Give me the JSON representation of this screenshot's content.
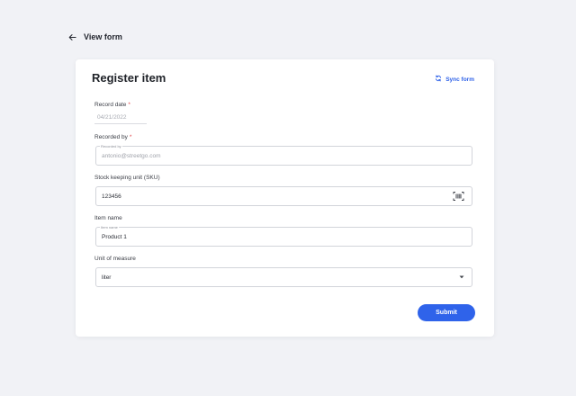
{
  "nav": {
    "back_label": "View form"
  },
  "form": {
    "title": "Register item",
    "sync_label": "Sync form",
    "record_date": {
      "label": "Record date",
      "required": "*",
      "value": "04/21/2022"
    },
    "recorded_by": {
      "label": "Recorded by",
      "required": "*",
      "floating_label": "Recorded by",
      "value": "antonio@streetgo.com"
    },
    "sku": {
      "label": "Stock keeping unit (SKU)",
      "value": "123456"
    },
    "item_name": {
      "label": "Item name",
      "floating_label": "Item name",
      "value": "Product 1"
    },
    "unit": {
      "label": "Unit of measure",
      "value": "liter"
    },
    "submit_label": "Submit"
  },
  "colors": {
    "accent": "#2f63ea",
    "required": "#e0464b",
    "background": "#f1f2f6"
  },
  "icons": [
    "back-arrow-icon",
    "sync-icon",
    "barcode-scan-icon",
    "caret-down-icon"
  ]
}
